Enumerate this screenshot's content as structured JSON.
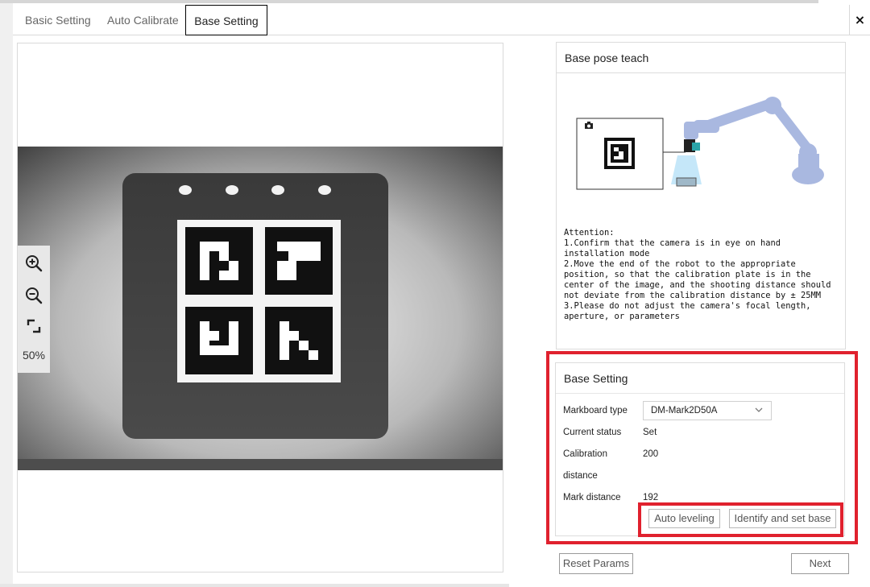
{
  "tabs": {
    "basic": "Basic Setting",
    "auto": "Auto Calibrate",
    "base": "Base Setting"
  },
  "close_label": "×",
  "viewer": {
    "zoom_percent": "50%"
  },
  "teach": {
    "title": "Base pose teach",
    "attention": "Attention:\n1.Confirm that the camera is in eye on hand installation mode\n2.Move the end of the robot to the appropriate position, so that the calibration plate is in the center of the image, and the shooting distance should not deviate from the calibration distance by ± 25MM\n3.Please do not adjust the camera's focal length, aperture, or parameters"
  },
  "base_setting": {
    "title": "Base Setting",
    "markboard_label": "Markboard type",
    "markboard_value": "DM-Mark2D50A",
    "status_label": "Current status",
    "status_value": "Set",
    "calib_label_1": "Calibration",
    "calib_label_2": "distance",
    "calib_value": "200",
    "mark_label": "Mark distance",
    "mark_value": "192",
    "auto_leveling": "Auto leveling",
    "identify": "Identify and set base"
  },
  "footer": {
    "reset": "Reset Params",
    "next": "Next"
  },
  "colors": {
    "highlight": "#e0212e"
  }
}
